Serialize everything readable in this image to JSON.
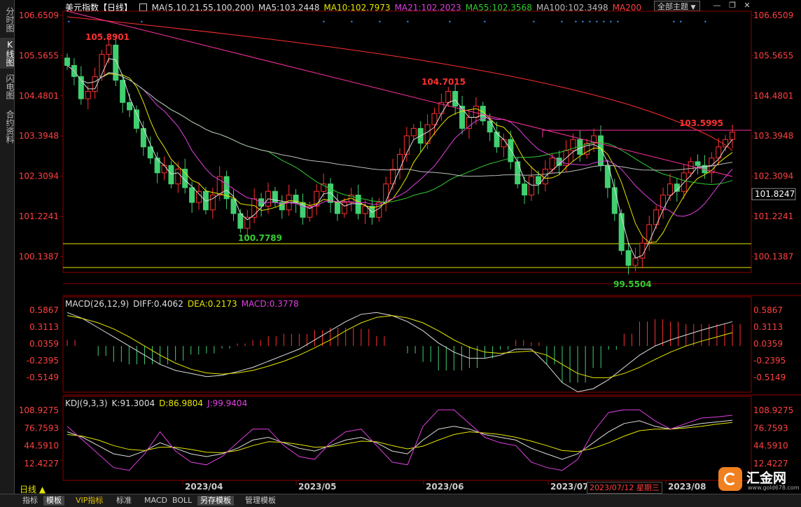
{
  "sidebar": [
    "分时图",
    "K线图",
    "闪电图",
    "合约资料"
  ],
  "header": {
    "title": "美元指数【日线】",
    "ma_items": [
      {
        "label": "MA(5,10,21,55,100,200)",
        "color": "#dddddd"
      },
      {
        "label": "MA5:103.2448",
        "color": "#dddddd"
      },
      {
        "label": "MA10:102.7973",
        "color": "#e6e600"
      },
      {
        "label": "MA21:102.2023",
        "color": "#e040e0"
      },
      {
        "label": "MA55:102.3568",
        "color": "#33cc33"
      },
      {
        "label": "MA100:102.3498",
        "color": "#bbbbbb"
      },
      {
        "label": "MA200",
        "color": "#ff4040"
      }
    ],
    "theme_button": "全部主题",
    "theme_arrow": "▼"
  },
  "main_axis": {
    "ticks": [
      "106.6509",
      "105.5655",
      "104.4801",
      "103.3948",
      "102.3094",
      "101.2241",
      "100.1387"
    ],
    "tick_values": [
      106.6509,
      105.5655,
      104.4801,
      103.3948,
      102.3094,
      101.2241,
      100.1387
    ],
    "current_price": "101.8247"
  },
  "annotations": [
    {
      "text": "105.8901",
      "color": "#ff3030"
    },
    {
      "text": "104.7015",
      "color": "#ff3030"
    },
    {
      "text": "103.5995",
      "color": "#ff3030"
    },
    {
      "text": "100.7789",
      "color": "#33cc33"
    },
    {
      "text": "99.5504",
      "color": "#33cc33"
    }
  ],
  "macd": {
    "title": "MACD(26,12,9)",
    "diff": "DIFF:0.4062",
    "dea": "DEA:0.2173",
    "macd": "MACD:0.3778",
    "ticks": [
      "0.5867",
      "0.3113",
      "0.0359",
      "-0.2395",
      "-0.5149"
    ],
    "tick_values": [
      0.5867,
      0.3113,
      0.0359,
      -0.2395,
      -0.5149
    ]
  },
  "kdj": {
    "title": "KDJ(9,3,3)",
    "k": "K:91.3004",
    "d": "D:86.9804",
    "j": "J:99.9404",
    "ticks": [
      "108.9275",
      "76.7593",
      "44.5910",
      "12.4227"
    ],
    "tick_values": [
      108.9275,
      76.7593,
      44.591,
      12.4227
    ]
  },
  "x_axis": {
    "period_label": "日线 ▲",
    "dates": [
      "2023/04",
      "2023/05",
      "2023/06",
      "2023/07",
      "2023/08"
    ],
    "cursor_date": "2023/07/12 星期三"
  },
  "bottom_tabs": [
    "指标",
    "模板",
    "VIP指标",
    "标准",
    "MACD",
    "BOLL",
    "另存模板",
    "管理模板"
  ],
  "logo": {
    "name": "汇金网",
    "url": "www.gold678.com"
  },
  "chart_data": {
    "type": "candlestick",
    "title": "美元指数【日线】",
    "price_range": [
      99.5504,
      106.6509
    ],
    "series": [
      {
        "name": "MA5",
        "value": 103.2448
      },
      {
        "name": "MA10",
        "value": 102.7973
      },
      {
        "name": "MA21",
        "value": 102.2023
      },
      {
        "name": "MA55",
        "value": 102.3568
      },
      {
        "name": "MA100",
        "value": 102.3498
      }
    ],
    "marked_values": {
      "high1": 105.8901,
      "high2": 104.7015,
      "high3": 103.5995,
      "low1": 100.7789,
      "low2": 99.5504
    },
    "close_path": [
      105.3,
      105.0,
      104.4,
      104.6,
      105.0,
      105.6,
      105.85,
      104.9,
      104.3,
      104.1,
      103.6,
      103.1,
      102.8,
      102.4,
      102.6,
      102.1,
      102.5,
      102.0,
      101.6,
      101.9,
      101.4,
      101.8,
      102.3,
      101.7,
      101.3,
      100.9,
      101.2,
      101.7,
      101.5,
      101.9,
      101.6,
      101.4,
      101.8,
      101.6,
      101.2,
      101.5,
      101.9,
      102.1,
      101.6,
      101.3,
      101.6,
      101.8,
      101.3,
      101.5,
      101.2,
      101.6,
      102.1,
      102.5,
      102.9,
      103.4,
      103.6,
      103.2,
      103.7,
      104.0,
      104.3,
      104.6,
      104.2,
      103.6,
      103.9,
      104.2,
      103.8,
      103.5,
      103.1,
      103.3,
      102.7,
      102.1,
      101.8,
      102.3,
      102.1,
      102.5,
      102.8,
      102.6,
      103.0,
      103.3,
      102.9,
      103.2,
      103.4,
      102.6,
      102.0,
      101.3,
      100.3,
      99.9,
      100.1,
      100.5,
      101.0,
      101.4,
      101.8,
      102.1,
      101.9,
      102.4,
      102.7,
      102.6,
      102.4,
      102.8,
      103.1,
      103.3,
      103.5
    ],
    "macd_diff": [
      0.55,
      0.45,
      0.3,
      0.15,
      0.0,
      -0.15,
      -0.3,
      -0.4,
      -0.45,
      -0.5,
      -0.48,
      -0.42,
      -0.35,
      -0.25,
      -0.15,
      -0.05,
      0.1,
      0.25,
      0.4,
      0.52,
      0.55,
      0.5,
      0.4,
      0.25,
      0.05,
      -0.1,
      -0.2,
      -0.2,
      -0.15,
      -0.05,
      -0.05,
      -0.3,
      -0.6,
      -0.75,
      -0.7,
      -0.55,
      -0.35,
      -0.15,
      0.0,
      0.1,
      0.18,
      0.26,
      0.33,
      0.4
    ],
    "macd_dea": [
      0.5,
      0.45,
      0.38,
      0.28,
      0.15,
      0.0,
      -0.15,
      -0.28,
      -0.38,
      -0.44,
      -0.46,
      -0.44,
      -0.4,
      -0.33,
      -0.25,
      -0.15,
      -0.03,
      0.1,
      0.25,
      0.38,
      0.47,
      0.5,
      0.46,
      0.38,
      0.25,
      0.1,
      -0.02,
      -0.1,
      -0.12,
      -0.1,
      -0.08,
      -0.15,
      -0.3,
      -0.45,
      -0.52,
      -0.52,
      -0.45,
      -0.35,
      -0.22,
      -0.1,
      0.0,
      0.08,
      0.15,
      0.22
    ],
    "kdj_k": [
      70,
      60,
      45,
      30,
      25,
      35,
      50,
      40,
      30,
      25,
      30,
      40,
      55,
      60,
      50,
      40,
      35,
      45,
      55,
      60,
      50,
      35,
      30,
      55,
      75,
      80,
      75,
      65,
      60,
      55,
      40,
      30,
      20,
      30,
      50,
      70,
      85,
      90,
      80,
      75,
      80,
      85,
      88,
      91
    ],
    "kdj_d": [
      65,
      62,
      55,
      45,
      38,
      36,
      42,
      42,
      38,
      33,
      32,
      36,
      45,
      52,
      51,
      47,
      42,
      43,
      48,
      53,
      52,
      45,
      39,
      44,
      55,
      65,
      70,
      68,
      65,
      60,
      53,
      45,
      36,
      34,
      40,
      50,
      62,
      72,
      75,
      75,
      77,
      80,
      84,
      87
    ],
    "kdj_j": [
      80,
      55,
      30,
      5,
      0,
      30,
      70,
      35,
      15,
      10,
      25,
      50,
      75,
      75,
      45,
      25,
      20,
      50,
      70,
      75,
      45,
      15,
      10,
      80,
      110,
      110,
      85,
      60,
      50,
      45,
      15,
      5,
      0,
      20,
      70,
      105,
      110,
      110,
      90,
      75,
      85,
      95,
      97,
      100
    ]
  }
}
